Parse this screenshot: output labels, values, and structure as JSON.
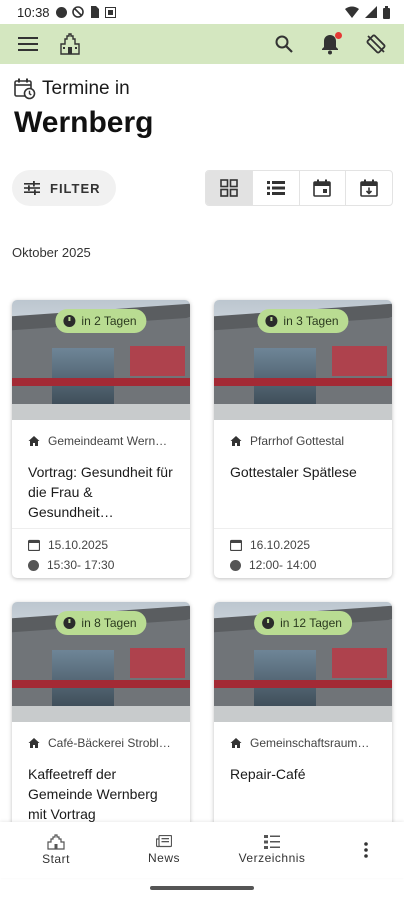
{
  "status_bar": {
    "time": "10:38",
    "icons_left": [
      "notification-dot-icon",
      "blocked-icon",
      "sim-icon",
      "photo-icon"
    ],
    "icons_right": [
      "wifi-icon",
      "signal-icon",
      "battery-icon"
    ]
  },
  "app_bar": {
    "menu_icon": "menu-icon",
    "logo_icon": "town-hall-icon",
    "search_icon": "search-icon",
    "bell_icon": "bell-icon",
    "bell_has_badge": true,
    "rotate_icon": "screen-rotation-icon",
    "background_color": "#d4e7c0"
  },
  "header": {
    "subtitle": "Termine in",
    "title": "Wernberg"
  },
  "filter": {
    "label": "FILTER"
  },
  "view_toggles": [
    {
      "name": "grid-view",
      "active": true
    },
    {
      "name": "list-view",
      "active": false
    },
    {
      "name": "calendar-view",
      "active": false
    },
    {
      "name": "calendar-download-view",
      "active": false
    }
  ],
  "month_label": "Oktober 2025",
  "events": [
    {
      "badge": "in 2 Tagen",
      "location": "Gemeindeamt Wern…",
      "title": "Vortrag: Gesundheit für die Frau & Gesundheit…",
      "date": "15.10.2025",
      "time": "15:30- 17:30"
    },
    {
      "badge": "in 3 Tagen",
      "location": "Pfarrhof Gottestal",
      "title": "Gottestaler Spätlese",
      "date": "16.10.2025",
      "time": "12:00- 14:00"
    },
    {
      "badge": "in 8 Tagen",
      "location": "Café-Bäckerei Strobl…",
      "title": "Kaffeetreff der Gemeinde Wernberg mit Vortrag",
      "date": "",
      "time": ""
    },
    {
      "badge": "in 12 Tagen",
      "location": "Gemeinschaftsraum…",
      "title": "Repair-Café",
      "date": "",
      "time": ""
    }
  ],
  "bottom_nav": {
    "start": "Start",
    "news": "News",
    "directory": "Verzeichnis",
    "more_icon": "more-vertical-icon"
  },
  "colors": {
    "accent_green": "#b9dc92",
    "appbar_green": "#d4e7c0",
    "notification_red": "#e53935"
  }
}
